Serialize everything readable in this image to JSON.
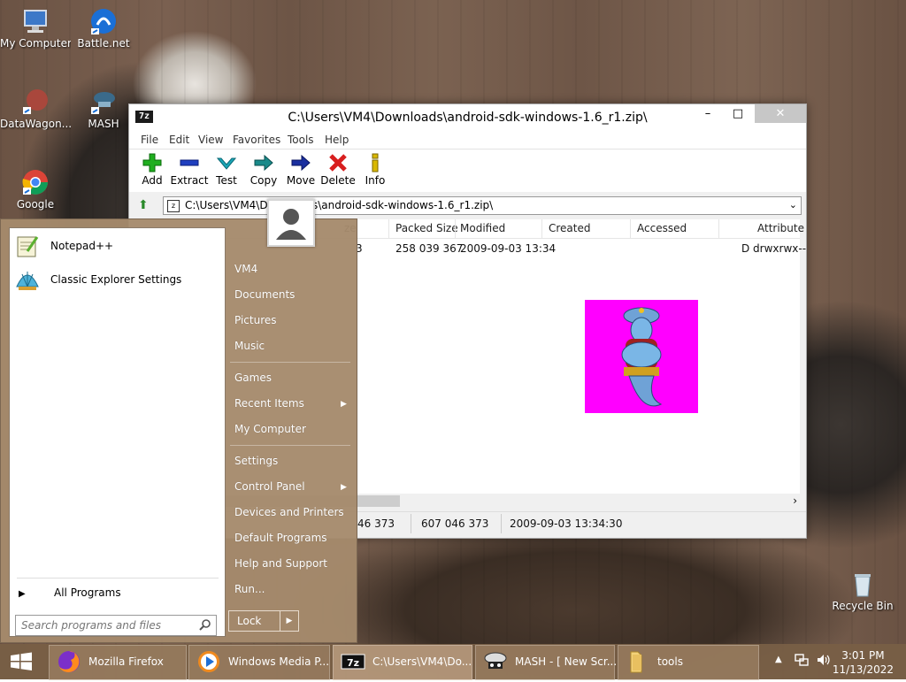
{
  "desktop": {
    "icons": [
      {
        "label": "My Computer"
      },
      {
        "label": "Battle.net"
      },
      {
        "label": "DataWagon..."
      },
      {
        "label": "MASH"
      },
      {
        "label": "Google Chrome"
      },
      {
        "label": "Recycle Bin"
      }
    ]
  },
  "window": {
    "app_icon": "7z",
    "title": "C:\\Users\\VM4\\Downloads\\android-sdk-windows-1.6_r1.zip\\",
    "minimize": "–",
    "maximize": "□",
    "close": "✕",
    "menu": [
      "File",
      "Edit",
      "View",
      "Favorites",
      "Tools",
      "Help"
    ],
    "toolbar": [
      {
        "label": "Add",
        "icon": "plus-icon",
        "color": "#1fae1f"
      },
      {
        "label": "Extract",
        "icon": "minus-icon",
        "color": "#1f3fbf"
      },
      {
        "label": "Test",
        "icon": "check-icon",
        "color": "#1aa6b7"
      },
      {
        "label": "Copy",
        "icon": "copy-arrow-icon",
        "color": "#1a8a8a"
      },
      {
        "label": "Move",
        "icon": "move-arrow-icon",
        "color": "#1a2f9f"
      },
      {
        "label": "Delete",
        "icon": "delete-icon",
        "color": "#d81f1f"
      },
      {
        "label": "Info",
        "icon": "info-icon",
        "color": "#d9b800"
      }
    ],
    "address": "C:\\Users\\VM4\\Downloads\\android-sdk-windows-1.6_r1.zip\\",
    "columns": [
      "ze",
      "Packed Size",
      "Modified",
      "Created",
      "Accessed",
      "Attribute"
    ],
    "row": {
      "size": "3",
      "packed": "258 039 367",
      "modified": "2009-09-03 13:34",
      "attributes": "D drwxrwx--"
    },
    "status": [
      "46 373",
      "607 046 373",
      "2009-09-03 13:34:30"
    ]
  },
  "start_menu": {
    "pinned": [
      {
        "label": "Notepad++",
        "icon": "notepad-plus-plus-icon"
      },
      {
        "label": "Classic Explorer Settings",
        "icon": "classic-shell-icon"
      }
    ],
    "all_programs": "All Programs",
    "search_placeholder": "Search programs and files",
    "right_items": [
      "VM4",
      "Documents",
      "Pictures",
      "Music",
      "Games",
      "Recent Items",
      "My Computer",
      "Settings",
      "Control Panel",
      "Devices and Printers",
      "Default Programs",
      "Help and Support",
      "Run..."
    ],
    "lock": "Lock"
  },
  "taskbar": {
    "items": [
      {
        "label": "Mozilla Firefox",
        "icon": "firefox-icon"
      },
      {
        "label": "Windows Media P...",
        "icon": "media-player-icon"
      },
      {
        "label": "C:\\Users\\VM4\\Do...",
        "icon": "7zip-icon"
      },
      {
        "label": "MASH - [ New Scr...",
        "icon": "mash-icon"
      },
      {
        "label": "tools",
        "icon": "folder-icon"
      }
    ],
    "time": "3:01 PM",
    "date": "11/13/2022"
  }
}
